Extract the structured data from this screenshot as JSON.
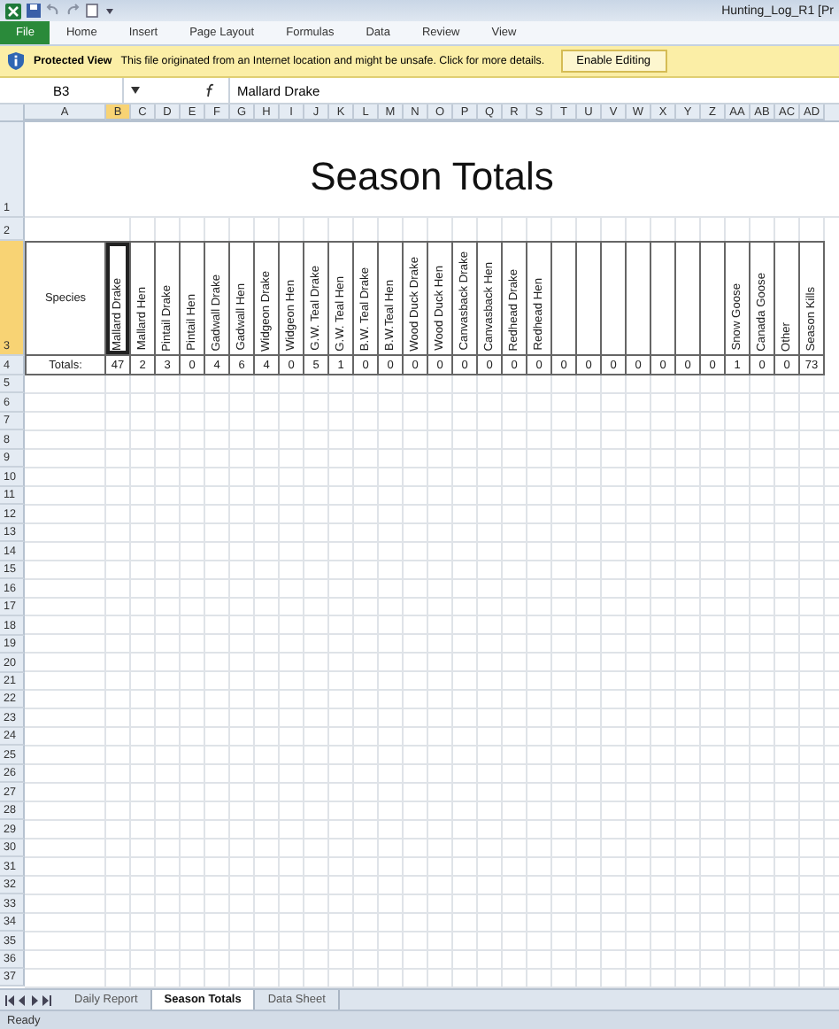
{
  "window": {
    "title": "Hunting_Log_R1  [Pr"
  },
  "ribbon_tabs": [
    {
      "label": "File",
      "selected": true
    },
    {
      "label": "Home",
      "selected": false
    },
    {
      "label": "Insert",
      "selected": false
    },
    {
      "label": "Page Layout",
      "selected": false
    },
    {
      "label": "Formulas",
      "selected": false
    },
    {
      "label": "Data",
      "selected": false
    },
    {
      "label": "Review",
      "selected": false
    },
    {
      "label": "View",
      "selected": false
    }
  ],
  "protected_view": {
    "title": "Protected View",
    "message": "This file originated from an Internet location and might be unsafe. Click for more details.",
    "button": "Enable Editing"
  },
  "formula_bar": {
    "name_box": "B3",
    "formula": "Mallard Drake"
  },
  "column_headers": [
    {
      "label": "A",
      "selected": false
    },
    {
      "label": "B",
      "selected": true
    },
    {
      "label": "C",
      "selected": false
    },
    {
      "label": "D",
      "selected": false
    },
    {
      "label": "E",
      "selected": false
    },
    {
      "label": "F",
      "selected": false
    },
    {
      "label": "G",
      "selected": false
    },
    {
      "label": "H",
      "selected": false
    },
    {
      "label": "I",
      "selected": false
    },
    {
      "label": "J",
      "selected": false
    },
    {
      "label": "K",
      "selected": false
    },
    {
      "label": "L",
      "selected": false
    },
    {
      "label": "M",
      "selected": false
    },
    {
      "label": "N",
      "selected": false
    },
    {
      "label": "O",
      "selected": false
    },
    {
      "label": "P",
      "selected": false
    },
    {
      "label": "Q",
      "selected": false
    },
    {
      "label": "R",
      "selected": false
    },
    {
      "label": "S",
      "selected": false
    },
    {
      "label": "T",
      "selected": false
    },
    {
      "label": "U",
      "selected": false
    },
    {
      "label": "V",
      "selected": false
    },
    {
      "label": "W",
      "selected": false
    },
    {
      "label": "X",
      "selected": false
    },
    {
      "label": "Y",
      "selected": false
    },
    {
      "label": "Z",
      "selected": false
    },
    {
      "label": "AA",
      "selected": false
    },
    {
      "label": "AB",
      "selected": false
    },
    {
      "label": "AC",
      "selected": false
    },
    {
      "label": "AD",
      "selected": false
    }
  ],
  "row_headers": [
    {
      "label": "1",
      "selected": false
    },
    {
      "label": "2",
      "selected": false
    },
    {
      "label": "3",
      "selected": true
    },
    {
      "label": "4",
      "selected": false
    },
    {
      "label": "5",
      "selected": false
    },
    {
      "label": "6",
      "selected": false
    },
    {
      "label": "7",
      "selected": false
    },
    {
      "label": "8",
      "selected": false
    },
    {
      "label": "9",
      "selected": false
    },
    {
      "label": "10",
      "selected": false
    },
    {
      "label": "11",
      "selected": false
    },
    {
      "label": "12",
      "selected": false
    },
    {
      "label": "13",
      "selected": false
    },
    {
      "label": "14",
      "selected": false
    },
    {
      "label": "15",
      "selected": false
    },
    {
      "label": "16",
      "selected": false
    },
    {
      "label": "17",
      "selected": false
    },
    {
      "label": "18",
      "selected": false
    },
    {
      "label": "19",
      "selected": false
    },
    {
      "label": "20",
      "selected": false
    },
    {
      "label": "21",
      "selected": false
    },
    {
      "label": "22",
      "selected": false
    },
    {
      "label": "23",
      "selected": false
    },
    {
      "label": "24",
      "selected": false
    },
    {
      "label": "25",
      "selected": false
    },
    {
      "label": "26",
      "selected": false
    },
    {
      "label": "27",
      "selected": false
    },
    {
      "label": "28",
      "selected": false
    },
    {
      "label": "29",
      "selected": false
    },
    {
      "label": "30",
      "selected": false
    },
    {
      "label": "31",
      "selected": false
    },
    {
      "label": "32",
      "selected": false
    },
    {
      "label": "33",
      "selected": false
    },
    {
      "label": "34",
      "selected": false
    },
    {
      "label": "35",
      "selected": false
    },
    {
      "label": "36",
      "selected": false
    },
    {
      "label": "37",
      "selected": false
    }
  ],
  "sheet": {
    "title": "Season Totals",
    "species_label": "Species",
    "totals_label": "Totals:",
    "columns": [
      {
        "header": "Mallard Drake",
        "total": "47",
        "selected": true
      },
      {
        "header": "Mallard Hen",
        "total": "2",
        "selected": false
      },
      {
        "header": "Pintail Drake",
        "total": "3",
        "selected": false
      },
      {
        "header": "Pintail Hen",
        "total": "0",
        "selected": false
      },
      {
        "header": "Gadwall Drake",
        "total": "4",
        "selected": false
      },
      {
        "header": "Gadwall Hen",
        "total": "6",
        "selected": false
      },
      {
        "header": "Widgeon Drake",
        "total": "4",
        "selected": false
      },
      {
        "header": "Widgeon Hen",
        "total": "0",
        "selected": false
      },
      {
        "header": "G.W. Teal Drake",
        "total": "5",
        "selected": false
      },
      {
        "header": "G.W. Teal Hen",
        "total": "1",
        "selected": false
      },
      {
        "header": "B.W. Teal Drake",
        "total": "0",
        "selected": false
      },
      {
        "header": "B.W.Teal Hen",
        "total": "0",
        "selected": false
      },
      {
        "header": "Wood Duck Drake",
        "total": "0",
        "selected": false
      },
      {
        "header": "Wood Duck Hen",
        "total": "0",
        "selected": false
      },
      {
        "header": "Canvasback Drake",
        "total": "0",
        "selected": false
      },
      {
        "header": "Canvasback Hen",
        "total": "0",
        "selected": false
      },
      {
        "header": "Redhead Drake",
        "total": "0",
        "selected": false
      },
      {
        "header": "Redhead Hen",
        "total": "0",
        "selected": false
      },
      {
        "total": "0",
        "selected": false
      },
      {
        "total": "0",
        "selected": false
      },
      {
        "total": "0",
        "selected": false
      },
      {
        "total": "0",
        "selected": false
      },
      {
        "total": "0",
        "selected": false
      },
      {
        "total": "0",
        "selected": false
      },
      {
        "total": "0",
        "selected": false
      },
      {
        "header": "Snow Goose",
        "total": "1",
        "selected": false
      },
      {
        "header": "Canada Goose",
        "total": "0",
        "selected": false
      },
      {
        "header": "Other",
        "total": "0",
        "selected": false
      },
      {
        "header": "Season Kills",
        "total": "73",
        "selected": false
      }
    ]
  },
  "sheet_tabs": [
    {
      "label": "Daily Report",
      "selected": false
    },
    {
      "label": "Season Totals",
      "selected": true
    },
    {
      "label": "Data Sheet",
      "selected": false
    }
  ],
  "status_bar": {
    "text": "Ready"
  }
}
